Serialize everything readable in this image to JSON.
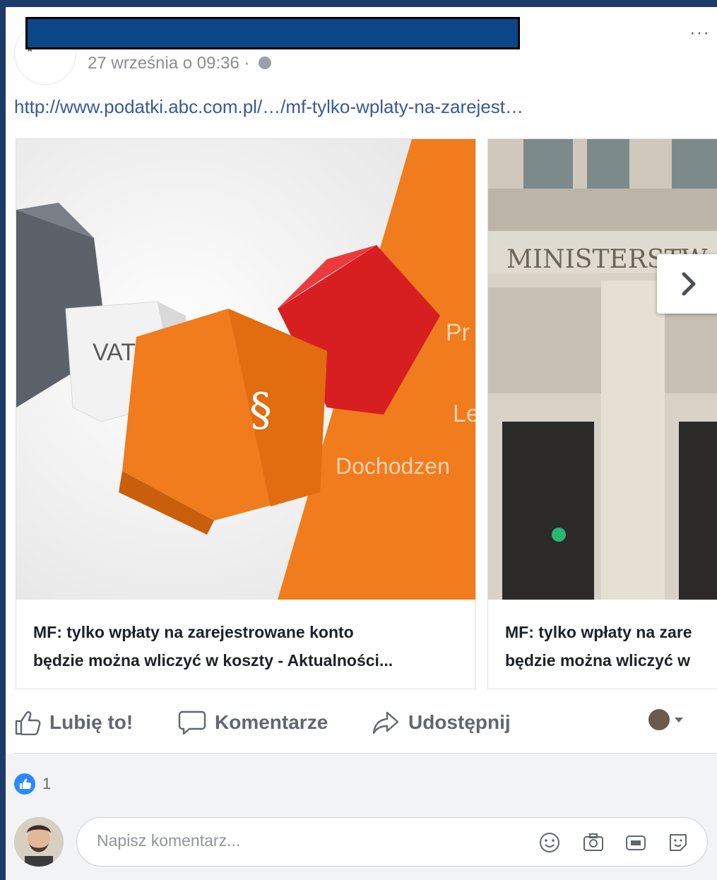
{
  "post": {
    "timestamp": "27 września o 09:36 ·",
    "link_text": "http://www.podatki.abc.com.pl/…/mf-tylko-wplaty-na-zarejest…",
    "more_label": "···"
  },
  "carousel": {
    "cards": [
      {
        "image_texts": {
          "vat": "VAT",
          "para": "§",
          "pr": "Pr",
          "le": "Le",
          "dochodzen": "Dochodzen"
        },
        "title_line1": "MF: tylko wpłaty na zarejestrowane konto",
        "title_line2": "będzie można wliczyć w koszty - Aktualności..."
      },
      {
        "image_texts": {
          "sign": "MINISTERSTW"
        },
        "title_line1": "MF: tylko wpłaty na zare",
        "title_line2": "będzie można wliczyć w"
      }
    ]
  },
  "actions": {
    "like": "Lubię to!",
    "comment": "Komentarze",
    "share": "Udostępnij"
  },
  "reactions": {
    "likes_count": "1"
  },
  "comment": {
    "placeholder": "Napisz komentarz..."
  },
  "colors": {
    "brand_blue": "#385898",
    "like_blue": "#2d88ff",
    "accent_orange": "#f07c1e",
    "redaction_blue": "#0b4687"
  }
}
